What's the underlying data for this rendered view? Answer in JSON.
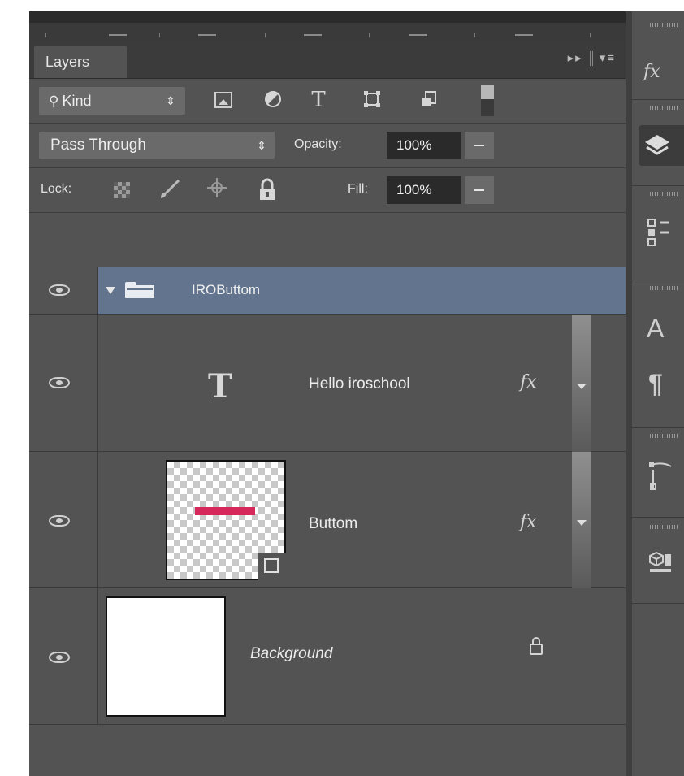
{
  "panel": {
    "tab_label": "Layers",
    "tab_icons": "▸▸",
    "menu_icon": "▾≡"
  },
  "filter": {
    "label": "Kind",
    "arrows": "⇕",
    "search_icon": "magnifier-icon",
    "icons": [
      "image-filter-icon",
      "adjustment-filter-icon",
      "type-filter-icon",
      "shape-filter-icon",
      "smart-object-filter-icon"
    ],
    "type_glyph": "T"
  },
  "blend": {
    "mode": "Pass Through",
    "arrows": "⇕",
    "opacity_label": "Opacity:",
    "opacity_value": "100%"
  },
  "lock": {
    "label": "Lock:",
    "fill_label": "Fill:",
    "fill_value": "100%"
  },
  "layers": [
    {
      "kind": "group",
      "name": "IROButtom",
      "visible": true,
      "expanded": true
    },
    {
      "kind": "text",
      "name": "Hello iroschool",
      "visible": true,
      "fx": "fx",
      "thumb_glyph": "T"
    },
    {
      "kind": "shape",
      "name": "Buttom",
      "visible": true,
      "fx": "fx",
      "shape_color": "#d6285a"
    },
    {
      "kind": "background",
      "name": "Background",
      "visible": true,
      "locked": true
    }
  ],
  "dock": {
    "fx_label": "fx",
    "character_label": "A",
    "paragraph_label": "¶"
  },
  "colors": {
    "panel_bg": "#535353",
    "selected_row": "#63758e",
    "shape_accent": "#d6285a"
  }
}
